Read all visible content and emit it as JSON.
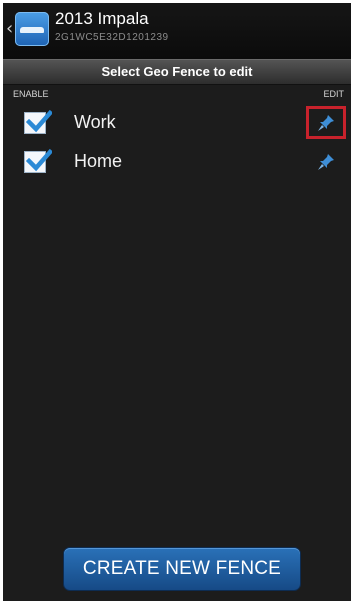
{
  "header": {
    "back_glyph": "‹",
    "title": "2013 Impala",
    "vin": "2G1WC5E32D1201239"
  },
  "section": {
    "title": "Select Geo Fence to edit"
  },
  "columns": {
    "enable": "ENABLE",
    "edit": "EDIT"
  },
  "fences": [
    {
      "label": "Work",
      "enabled": true,
      "edit_icon": "pin-icon",
      "highlighted": true
    },
    {
      "label": "Home",
      "enabled": true,
      "edit_icon": "pin-icon",
      "highlighted": false
    }
  ],
  "footer": {
    "create_label": "CREATE NEW FENCE"
  },
  "colors": {
    "background": "#1c1c1c",
    "accent_blue": "#1f5fa3",
    "checkbox_blue": "#2b8ad6",
    "highlight_red": "#c8222c"
  }
}
